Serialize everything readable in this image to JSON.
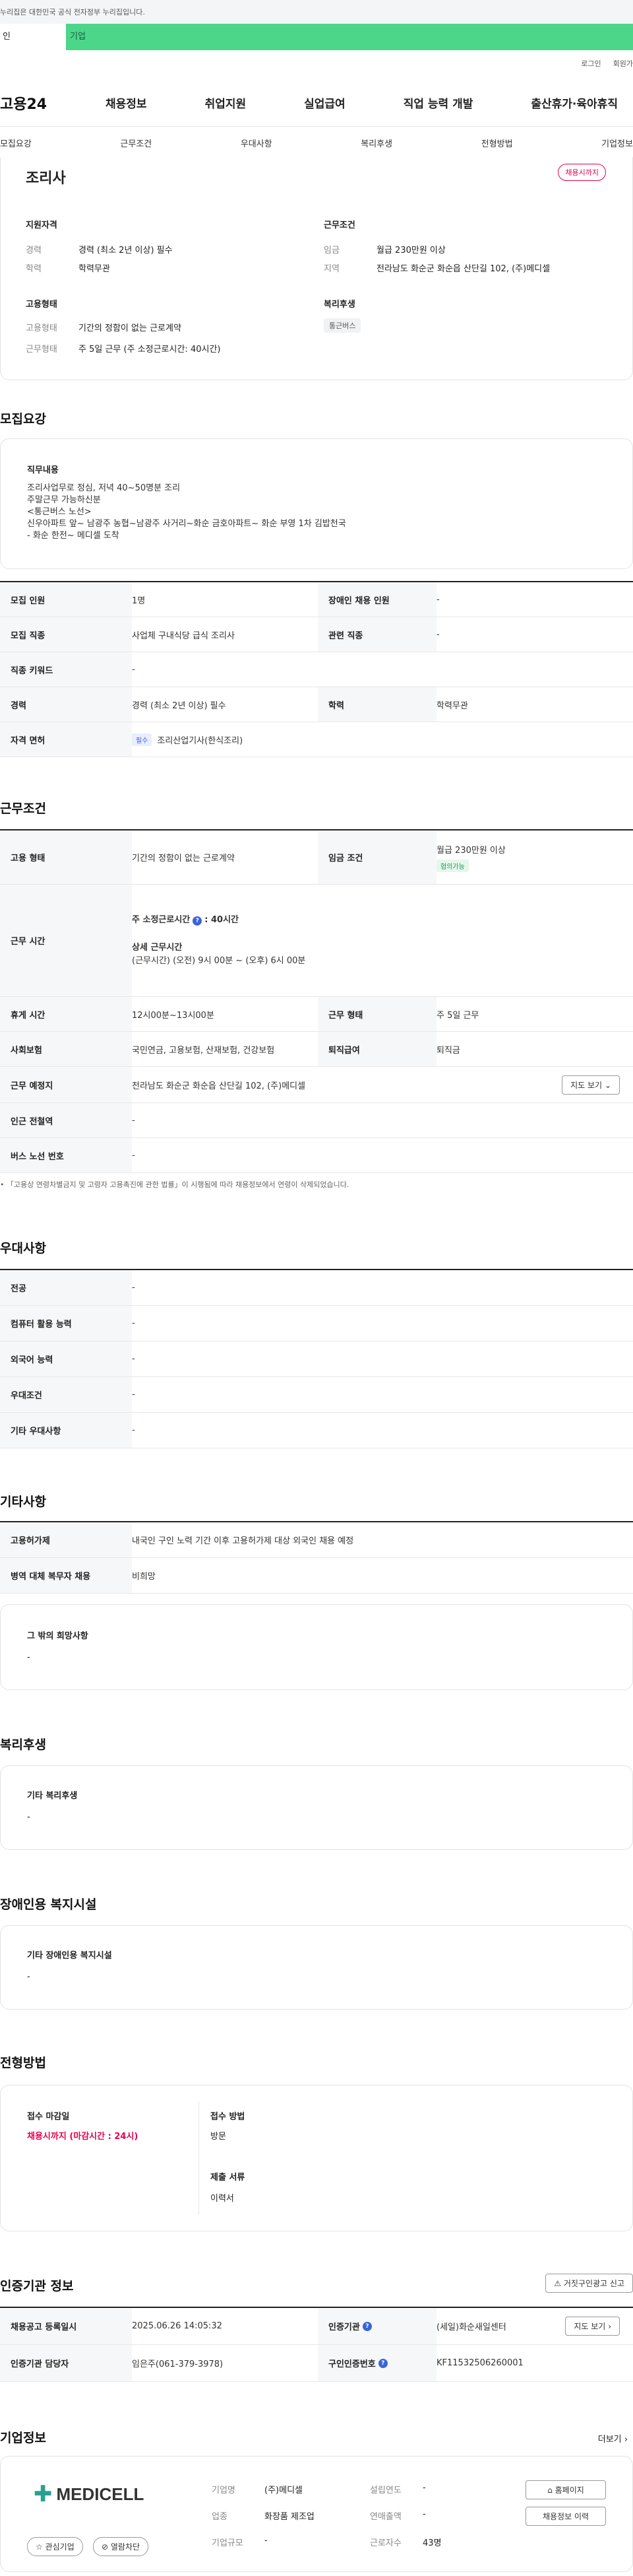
{
  "gov_banner": "누리집은 대한민국 공식 전자정부 누리집입니다.",
  "type_tabs": [
    "인",
    "기업"
  ],
  "util": [
    "로그인",
    "회원가"
  ],
  "logo": "고용24",
  "gnb": [
    "채용정보",
    "취업지원",
    "실업급여",
    "직업 능력 개발",
    "출산휴가·육아휴직"
  ],
  "anchors": [
    "모집요강",
    "근무조건",
    "우대사항",
    "복리후생",
    "전형방법",
    "기업정보"
  ],
  "summary": {
    "title": "조리사",
    "status": "채용시까지",
    "qual_title": "지원자격",
    "qual": [
      {
        "k": "경력",
        "v": "경력 (최소 2년 이상) 필수"
      },
      {
        "k": "학력",
        "v": "학력무관"
      }
    ],
    "cond_title": "근무조건",
    "cond": [
      {
        "k": "임금",
        "v": "월급 230만원 이상"
      },
      {
        "k": "지역",
        "v": "전라남도 화순군 화순읍 산단길 102, (주)메디셀"
      }
    ],
    "emp_title": "고용형태",
    "emp": [
      {
        "k": "고용형태",
        "v": "기간의 정함이 없는 근로계약"
      },
      {
        "k": "근무형태",
        "v": "주 5일 근무 (주 소정근로시간: 40시간)"
      }
    ],
    "welfare_title": "복리후생",
    "welfare_chip": "통근버스"
  },
  "recruit": {
    "title": "모집요강",
    "duty_title": "직무내용",
    "duty_lines": [
      "조리사업무로 정심, 저녁 40~50명분 조리",
      "주말근무 가능하신분",
      "<통근버스 노선>",
      "신우아파트 앞~ 남광주 농협~남광주 사거리~화순 금호아파트~ 화순 부영 1차 김밥천국",
      "- 화순 한전~ 메디셀 도착"
    ],
    "rows": [
      {
        "c": [
          {
            "th": "모집 인원",
            "td": "1명"
          },
          {
            "th": "장애인 채용 인원",
            "td": "-"
          }
        ]
      },
      {
        "c": [
          {
            "th": "모집 직종",
            "td": "사업체 구내식당 급식 조리사"
          },
          {
            "th": "관련 직종",
            "td": "-"
          }
        ]
      },
      {
        "c": [
          {
            "th": "직종 키워드",
            "td": "-"
          }
        ]
      },
      {
        "c": [
          {
            "th": "경력",
            "td": "경력 (최소 2년 이상) 필수"
          },
          {
            "th": "학력",
            "td": "학력무관"
          }
        ]
      }
    ],
    "license_th": "자격 면허",
    "license_tag": "필수",
    "license_val": "조리산업기사(한식조리)"
  },
  "work": {
    "title": "근무조건",
    "emp_th": "고용 형태",
    "emp_td": "기간의 정함이 없는 근로계약",
    "wage_th": "임금 조건",
    "wage_td": "월급 230만원 이상",
    "wage_chip": "협의가능",
    "time_th": "근무 시간",
    "time_main": "주 소정근로시간",
    "time_hours": ": 40시간",
    "time_detail_title": "상세 근무시간",
    "time_detail": "(근무시간) (오전) 9시 00분 ~ (오후) 6시 00분",
    "rest_th": "휴게 시간",
    "rest_td": "12시00분~13시00분",
    "form_th": "근무 형태",
    "form_td": "주 5일 근무",
    "ins_th": "사회보험",
    "ins_td": "국민연금, 고용보험, 산재보험, 건강보험",
    "ret_th": "퇴직급여",
    "ret_td": "퇴직금",
    "place_th": "근무 예정지",
    "place_td": "전라남도 화순군 화순읍 산단길 102, (주)메디셀",
    "map_btn": "지도 보기",
    "sub_th": "인근 전철역",
    "sub_td": "-",
    "bus_th": "버스 노선 번호",
    "bus_td": "-",
    "note": "「고용상 연령차별금지 및 고령자 고용촉진에 관한 법률」이 시행됨에 따라 채용정보에서 연령이 삭제되었습니다."
  },
  "pref": {
    "title": "우대사항",
    "rows": [
      {
        "th": "전공",
        "td": "-"
      },
      {
        "th": "컴퓨터 활용 능력",
        "td": "-"
      },
      {
        "th": "외국어 능력",
        "td": "-"
      },
      {
        "th": "우대조건",
        "td": "-"
      },
      {
        "th": "기타 우대사항",
        "td": "-"
      }
    ]
  },
  "etc": {
    "title": "기타사항",
    "rows": [
      {
        "th": "고용허가제",
        "td": "내국인 구인 노력 기간 이후 고용허가제 대상 외국인 채용 예정"
      },
      {
        "th": "병역 대체 복무자 채용",
        "td": "비희망"
      }
    ],
    "hope_title": "그 밖의 희망사항",
    "hope_val": "-"
  },
  "welfare": {
    "title": "복리후생",
    "box_title": "기타 복리후생",
    "box_val": "-"
  },
  "disab": {
    "title": "장애인용 복지시설",
    "box_title": "기타 장애인용 복지시설",
    "box_val": "-"
  },
  "select": {
    "title": "전형방법",
    "deadline_title": "접수 마감일",
    "deadline_val": "채용시까지 (마감시간 : 24시)",
    "method_title": "접수 방법",
    "method_val": "방문",
    "docs_title": "제출 서류",
    "docs_val": "이력서"
  },
  "agency": {
    "title": "인증기관 정보",
    "report_btn": "거짓구인광고 신고",
    "reg_th": "채용공고 등록일시",
    "reg_td": "2025.06.26 14:05:32",
    "org_th": "인증기관",
    "org_td": "(세일)화순새일센터",
    "road_btn": "지도 보기",
    "mgr_th": "인증기관 담당자",
    "mgr_td": "임은주(061-379-3978)",
    "no_th": "구인인증번호",
    "no_td": "KF11532506260001"
  },
  "company": {
    "title": "기업정보",
    "more": "더보기",
    "logo_text": "MEDICELL",
    "fav_btn": "관심기업",
    "block_btn": "열람차단",
    "fields": [
      {
        "k": "기업명",
        "v": "(주)메디셀"
      },
      {
        "k": "업종",
        "v": "화장품 제조업"
      },
      {
        "k": "기업규모",
        "v": "-"
      }
    ],
    "fields2": [
      {
        "k": "설립연도",
        "v": "-"
      },
      {
        "k": "연매출액",
        "v": "-"
      },
      {
        "k": "근로자수",
        "v": "43명"
      }
    ],
    "home_btn": "홈페이지",
    "hist_btn": "채용정보 이력"
  }
}
